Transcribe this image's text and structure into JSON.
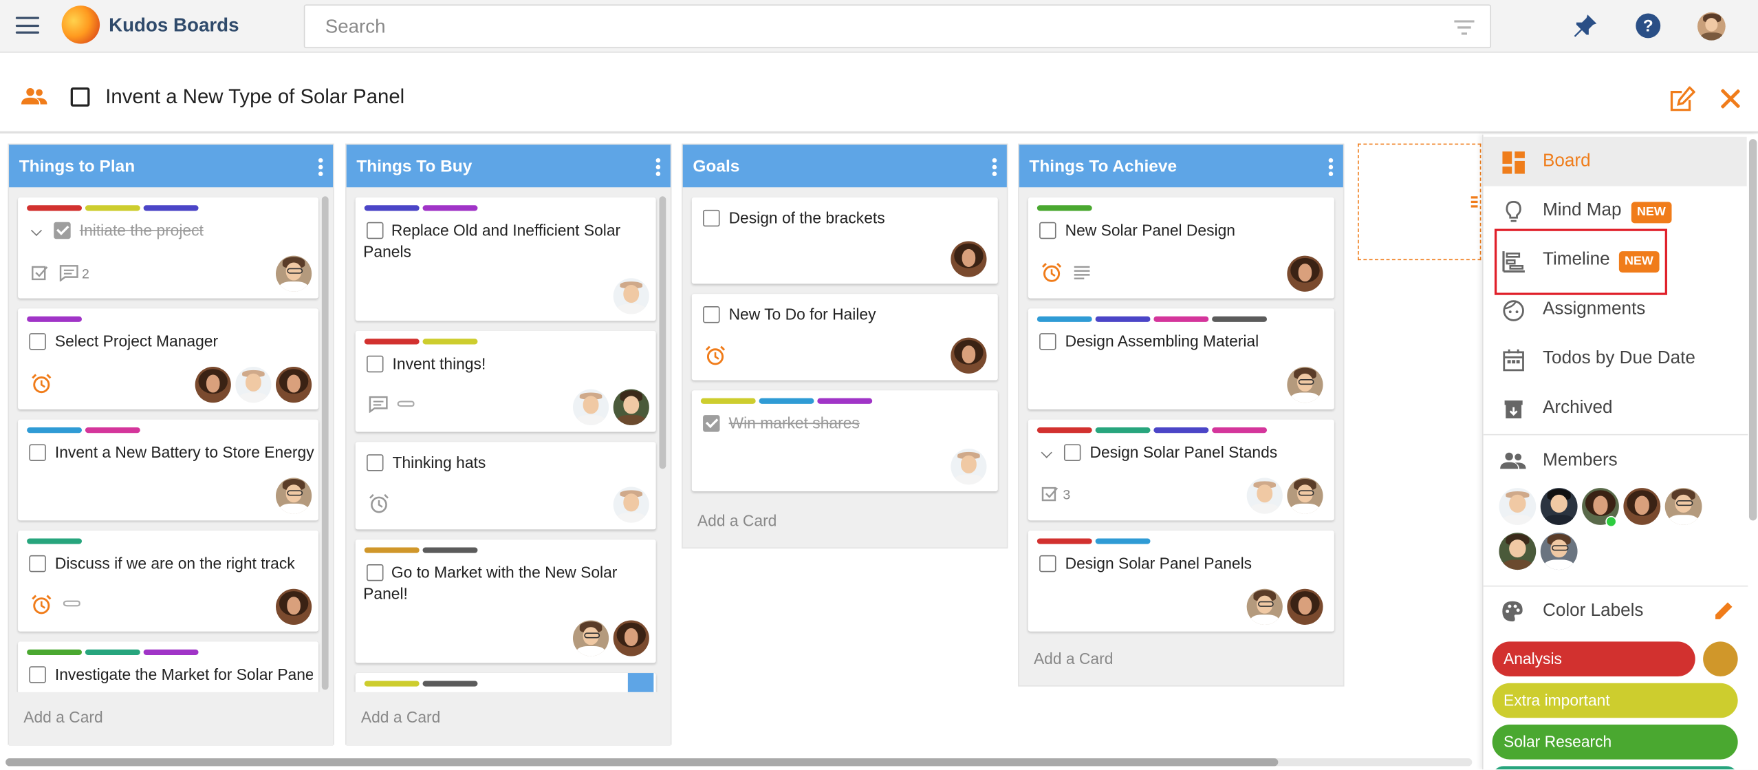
{
  "header": {
    "app_title": "Kudos Boards",
    "search_placeholder": "Search",
    "icons": [
      "menu-icon",
      "pin-icon",
      "help-icon",
      "user-avatar"
    ]
  },
  "board": {
    "title": "Invent a New Type of Solar Panel"
  },
  "colors": {
    "accent": "#f07c1a",
    "list_header": "#5ea5e6",
    "red": "#d2312f",
    "yellow": "#cdcd2e",
    "indigo": "#4b45c7",
    "purple": "#a034c7",
    "blue": "#2f9bd5",
    "pink": "#d4359b",
    "green": "#4aa830",
    "teal": "#27a57d",
    "gold": "#d0972a",
    "gray": "#5b5b5b"
  },
  "lists": [
    {
      "title": "Things to Plan",
      "add_card": "Add a Card",
      "cards": [
        {
          "title": "Initiate the project",
          "done": true,
          "comments": "2"
        },
        {
          "title": "Select Project Manager"
        },
        {
          "title": "Invent a New Battery to Store Energy"
        },
        {
          "title": "Discuss if we are on the right track"
        },
        {
          "title": "Investigate the Market for Solar Panels"
        }
      ]
    },
    {
      "title": "Things To Buy",
      "add_card": "Add a Card",
      "cards": [
        {
          "title": "Replace Old and Inefficient Solar Panels"
        },
        {
          "title": "Invent things!"
        },
        {
          "title": "Thinking hats"
        },
        {
          "title": "Go to Market with the New Solar Panel!"
        }
      ]
    },
    {
      "title": "Goals",
      "add_card": "Add a Card",
      "cards": [
        {
          "title": "Design of the brackets"
        },
        {
          "title": "New To Do for Hailey"
        },
        {
          "title": "Win market shares",
          "done": true
        }
      ]
    },
    {
      "title": "Things To Achieve",
      "add_card": "Add a Card",
      "cards": [
        {
          "title": "New Solar Panel Design"
        },
        {
          "title": "Design Assembling Material"
        },
        {
          "title": "Design Solar Panel Stands",
          "checklist": "3"
        },
        {
          "title": "Design Solar Panel Panels"
        }
      ]
    }
  ],
  "sidebar": {
    "views": [
      {
        "label": "Board",
        "active": true
      },
      {
        "label": "Mind Map",
        "badge": "NEW"
      },
      {
        "label": "Timeline",
        "badge": "NEW"
      },
      {
        "label": "Assignments"
      },
      {
        "label": "Todos by Due Date"
      },
      {
        "label": "Archived"
      }
    ],
    "members_label": "Members",
    "color_labels_label": "Color Labels",
    "color_labels": [
      {
        "label": "Analysis",
        "color": "#d2312f"
      },
      {
        "label": "Extra important",
        "color": "#cdcd2e"
      },
      {
        "label": "Solar Research",
        "color": "#4aa830"
      }
    ]
  }
}
